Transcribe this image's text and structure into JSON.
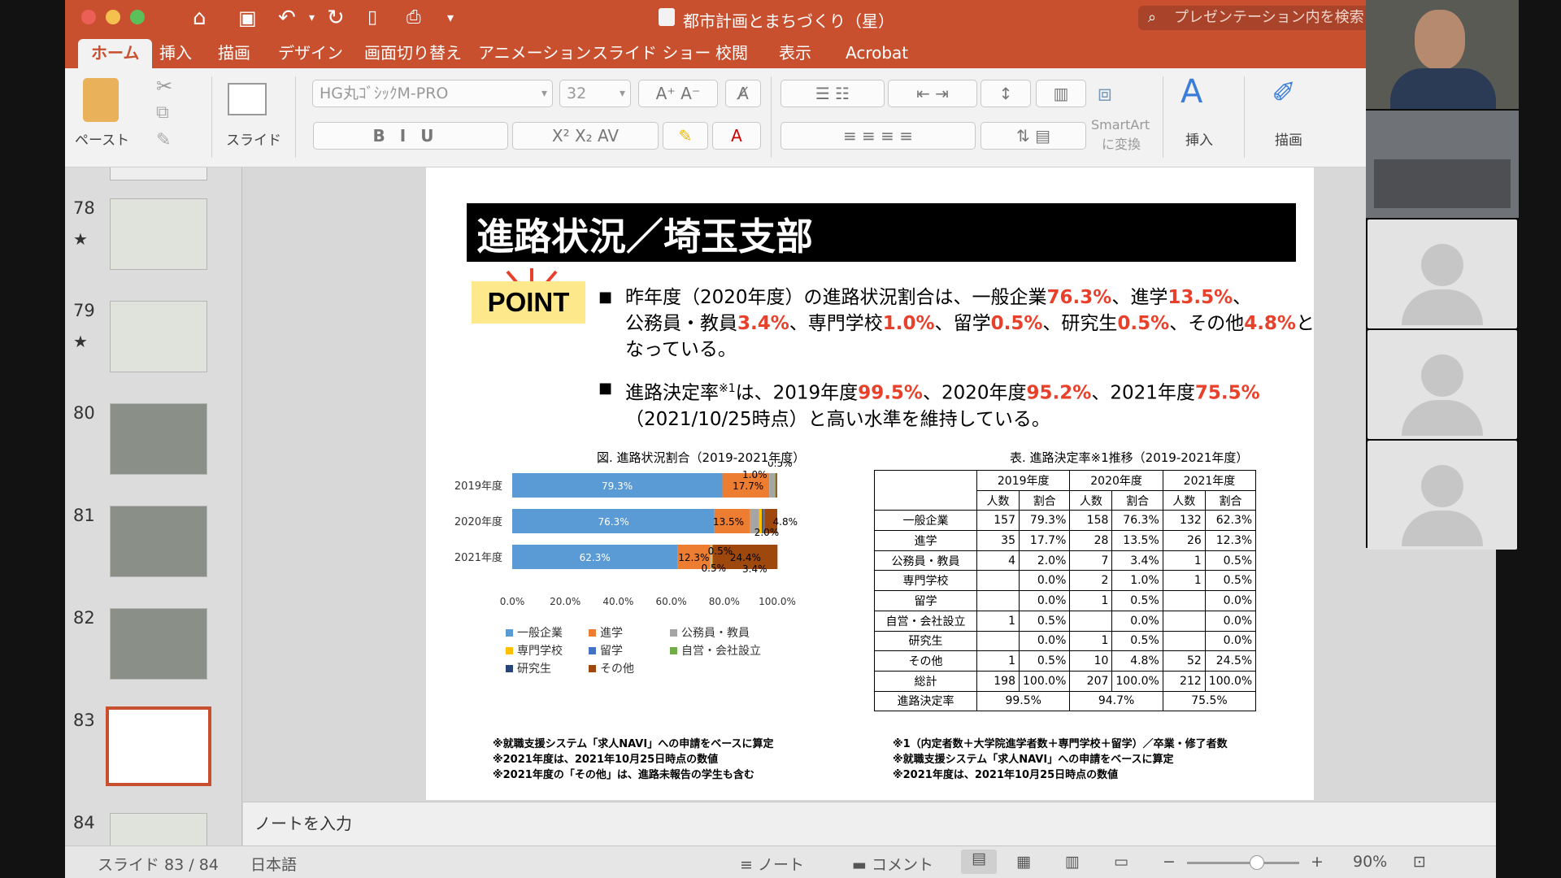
{
  "window": {
    "doc_title": "都市計画とまちづくり（星）",
    "search_placeholder": "プレゼンテーション内を検索"
  },
  "tabs": [
    {
      "label": "ホーム",
      "active": true
    },
    {
      "label": "挿入"
    },
    {
      "label": "描画"
    },
    {
      "label": "デザイン"
    },
    {
      "label": "画面切り替え"
    },
    {
      "label": "アニメーション"
    },
    {
      "label": "スライド ショー"
    },
    {
      "label": "校閲"
    },
    {
      "label": "表示"
    },
    {
      "label": "Acrobat"
    }
  ],
  "ribbon": {
    "paste_label": "ペースト",
    "slide_label": "スライド",
    "font_name": "HG丸ｺﾞｼｯｸM-PRO",
    "font_size": "32",
    "smartart_line1": "SmartArt",
    "smartart_line2": "に変換",
    "insert_label": "挿入",
    "draw_label": "描画"
  },
  "thumbnails": [
    {
      "num": "78",
      "star": "★"
    },
    {
      "num": "79",
      "star": "★"
    },
    {
      "num": "80",
      "star": ""
    },
    {
      "num": "81",
      "star": ""
    },
    {
      "num": "82",
      "star": ""
    },
    {
      "num": "83",
      "star": "",
      "selected": true
    },
    {
      "num": "84",
      "star": ""
    }
  ],
  "notes_placeholder": "ノートを入力",
  "status": {
    "slide_counter": "スライド 83 / 84",
    "language": "日本語",
    "notes_label": "ノート",
    "comments_label": "コメント",
    "zoom": "90%",
    "zoom_level": 0.62
  },
  "slide": {
    "title": "進路状況／埼玉支部",
    "point_label": "POINT",
    "bullet1": [
      {
        "t": "昨年度（2020年度）の進路状況割合は、一般企業"
      },
      {
        "t": "76.3%",
        "hl": true
      },
      {
        "t": "、進学"
      },
      {
        "t": "13.5%",
        "hl": true
      },
      {
        "t": "、"
      },
      {
        "br": true
      },
      {
        "t": "公務員・教員"
      },
      {
        "t": "3.4%",
        "hl": true
      },
      {
        "t": "、専門学校"
      },
      {
        "t": "1.0%",
        "hl": true
      },
      {
        "t": "、留学"
      },
      {
        "t": "0.5%",
        "hl": true
      },
      {
        "t": "、研究生"
      },
      {
        "t": "0.5%",
        "hl": true
      },
      {
        "t": "、その他"
      },
      {
        "t": "4.8%",
        "hl": true
      },
      {
        "t": "と"
      },
      {
        "br": true
      },
      {
        "t": "なっている。"
      }
    ],
    "bullet2": [
      {
        "t": "進路決定率"
      },
      {
        "t": "※1",
        "sup": true
      },
      {
        "t": "は、2019年度"
      },
      {
        "t": "99.5%",
        "hl": true
      },
      {
        "t": "、2020年度"
      },
      {
        "t": "95.2%",
        "hl": true
      },
      {
        "t": "、2021年度"
      },
      {
        "t": "75.5%",
        "hl": true
      },
      {
        "br": true
      },
      {
        "t": "（2021/10/25時点）と高い水準を維持している。"
      }
    ],
    "chart_caption": "図. 進路状況割合（2019-2021年度）",
    "table_caption": "表. 進路決定率※1推移（2019-2021年度）",
    "notes_left": [
      "※就職支援システム「求人NAVI」への申請をベースに算定",
      "※2021年度は、2021年10月25日時点の数値",
      "※2021年度の「その他」は、進路未報告の学生も含む"
    ],
    "notes_right": [
      "※1（内定者数＋大学院進学者数＋専門学校＋留学）／卒業・修了者数",
      "※就職支援システム「求人NAVI」への申請をベースに算定",
      "※2021年度は、2021年10月25日時点の数値"
    ],
    "table": {
      "years": [
        "2019年度",
        "2020年度",
        "2021年度"
      ],
      "sub_headers": [
        "人数",
        "割合"
      ],
      "rows": [
        {
          "label": "一般企業",
          "cells": [
            "157",
            "79.3%",
            "158",
            "76.3%",
            "132",
            "62.3%"
          ]
        },
        {
          "label": "進学",
          "cells": [
            "35",
            "17.7%",
            "28",
            "13.5%",
            "26",
            "12.3%"
          ]
        },
        {
          "label": "公務員・教員",
          "cells": [
            "4",
            "2.0%",
            "7",
            "3.4%",
            "1",
            "0.5%"
          ]
        },
        {
          "label": "専門学校",
          "cells": [
            "",
            "0.0%",
            "2",
            "1.0%",
            "1",
            "0.5%"
          ]
        },
        {
          "label": "留学",
          "cells": [
            "",
            "0.0%",
            "1",
            "0.5%",
            "",
            "0.0%"
          ]
        },
        {
          "label": "自営・会社設立",
          "cells": [
            "1",
            "0.5%",
            "",
            "0.0%",
            "",
            "0.0%"
          ]
        },
        {
          "label": "研究生",
          "cells": [
            "",
            "0.0%",
            "1",
            "0.5%",
            "",
            "0.0%"
          ]
        },
        {
          "label": "その他",
          "cells": [
            "1",
            "0.5%",
            "10",
            "4.8%",
            "52",
            "24.5%"
          ]
        },
        {
          "label": "総計",
          "cells": [
            "198",
            "100.0%",
            "207",
            "100.0%",
            "212",
            "100.0%"
          ]
        }
      ],
      "rate_row": {
        "label": "進路決定率",
        "cells": [
          "99.5%",
          "94.7%",
          "75.5%"
        ]
      }
    }
  },
  "chart_data": {
    "type": "bar",
    "orientation": "horizontal-stacked",
    "title": "図. 進路状況割合（2019-2021年度）",
    "categories": [
      "2019年度",
      "2020年度",
      "2021年度"
    ],
    "xlim": [
      0,
      100
    ],
    "x_ticks": [
      "0.0%",
      "20.0%",
      "40.0%",
      "60.0%",
      "80.0%",
      "100.0%"
    ],
    "legend_position": "bottom",
    "series": [
      {
        "name": "一般企業",
        "color": "#5b9bd5",
        "values": [
          79.3,
          76.3,
          62.3
        ]
      },
      {
        "name": "進学",
        "color": "#ed7d31",
        "values": [
          17.7,
          13.5,
          12.3
        ]
      },
      {
        "name": "公務員・教員",
        "color": "#a5a5a5",
        "values": [
          2.0,
          3.4,
          0.5
        ]
      },
      {
        "name": "自営・会社設立",
        "color": "#70ad47",
        "values": [
          0.5,
          0.0,
          0.0
        ]
      },
      {
        "name": "専門学校",
        "color": "#ffc000",
        "values": [
          0.0,
          1.0,
          0.5
        ]
      },
      {
        "name": "研究生",
        "color": "#264478",
        "values": [
          0.0,
          0.5,
          0.0
        ]
      },
      {
        "name": "留学",
        "color": "#4472c4",
        "values": [
          0.0,
          0.5,
          0.0
        ]
      },
      {
        "name": "その他",
        "color": "#9e480e",
        "values": [
          0.5,
          4.8,
          24.5
        ]
      }
    ],
    "legend_order": [
      "一般企業",
      "進学",
      "公務員・教員",
      "専門学校",
      "留学",
      "自営・会社設立",
      "研究生",
      "その他"
    ],
    "data_labels": [
      [
        "79.3%",
        "17.7%",
        "2.0%",
        "0.5%"
      ],
      [
        "76.3%",
        "13.5%",
        "1.0%",
        "3.4%",
        "4.8%"
      ],
      [
        "62.3%",
        "12.3%",
        "0.5%",
        "0.5%",
        "24.4%"
      ]
    ]
  },
  "colors": {
    "accent": "#c9502f",
    "highlight": "#e8402a"
  }
}
